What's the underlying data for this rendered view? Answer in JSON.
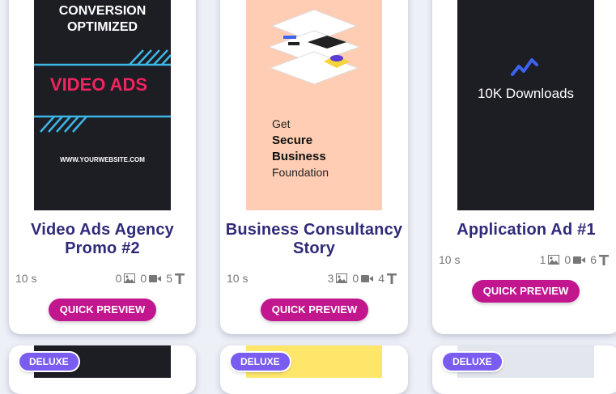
{
  "cards": [
    {
      "title": "Video Ads Agency Promo #2",
      "title_lines": [
        "Video Ads Agency",
        "Promo #2"
      ],
      "duration": "10 s",
      "images": "0",
      "videos": "0",
      "texts": "5",
      "button": "QUICK PREVIEW",
      "thumb": {
        "line1": "CONVERSION",
        "line2": "OPTIMIZED",
        "headline": "VIDEO ADS",
        "url": "WWW.YOURWEBSITE.COM"
      }
    },
    {
      "title": "Business Consultancy Story",
      "title_lines": [
        "Business Consultancy",
        "Story"
      ],
      "duration": "10 s",
      "images": "3",
      "videos": "0",
      "texts": "4",
      "button": "QUICK PREVIEW",
      "thumb": {
        "line1": "Get",
        "line2": "Secure",
        "line3": "Business",
        "line4": "Foundation"
      }
    },
    {
      "title": "Application Ad #1",
      "duration": "10 s",
      "images": "1",
      "videos": "0",
      "texts": "6",
      "button": "QUICK PREVIEW",
      "thumb": {
        "headline": "10K Downloads"
      }
    }
  ],
  "bottom_badges": [
    "DELUXE",
    "DELUXE",
    "DELUXE"
  ],
  "colors": {
    "accent": "#c2168f",
    "title": "#2f2a7a",
    "badge": "#7a5cf0",
    "peach": "#ffcdb3",
    "dark": "#1d1d24"
  }
}
